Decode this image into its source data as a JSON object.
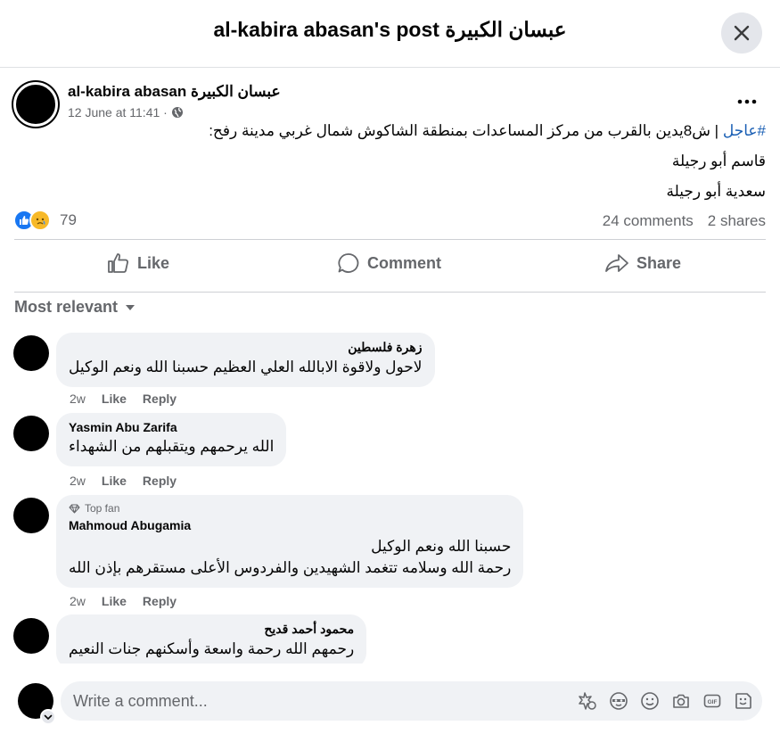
{
  "header": {
    "title": "al-kabira abasan's post عبسان الكبيرة"
  },
  "post": {
    "author": "al-kabira abasan عبسان الكبيرة",
    "timestamp": "12 June at 11:41 ·",
    "privacy_icon": "globe-icon",
    "hashtag": "#عاجل",
    "headline_rest": " | ش8يدين بالقرب من مركز المساعدات بمنطقة الشاكوش شمال غربي مدينة رفح:",
    "names": [
      "قاسم أبو رجيلة",
      "سعدية أبو رجيلة"
    ],
    "reaction_count": "79",
    "comments_count": "24 comments",
    "shares_count": "2 shares"
  },
  "actions": {
    "like": "Like",
    "comment": "Comment",
    "share": "Share"
  },
  "sort_label": "Most relevant",
  "comments": [
    {
      "author": "زهرة فلسطين",
      "text": "لاحول ولاقوة الابالله العلي العظيم حسبنا الله ونعم الوكيل",
      "time": "2w",
      "like": "Like",
      "reply": "Reply"
    },
    {
      "author": "Yasmin Abu Zarifa",
      "text": "الله يرحمهم ويتقبلهم من الشهداء",
      "time": "2w",
      "like": "Like",
      "reply": "Reply"
    },
    {
      "badge": "Top fan",
      "author": "Mahmoud Abugamia",
      "line1": "حسبنا الله ونعم الوكيل",
      "line2": "رحمة الله وسلامه تتغمد الشهيدين والفردوس الأعلى مستقرهم بإذن الله",
      "time": "2w",
      "like": "Like",
      "reply": "Reply"
    },
    {
      "author": "محمود أحمد قديح",
      "text": "رحمهم الله رحمة واسعة وأسكنهم جنات النعيم"
    }
  ],
  "composer": {
    "placeholder": "Write a comment..."
  },
  "colors": {
    "accent": "#1877f2",
    "hashtag": "#1a5fb4",
    "muted": "#65676b",
    "bubble": "#f0f2f5"
  }
}
